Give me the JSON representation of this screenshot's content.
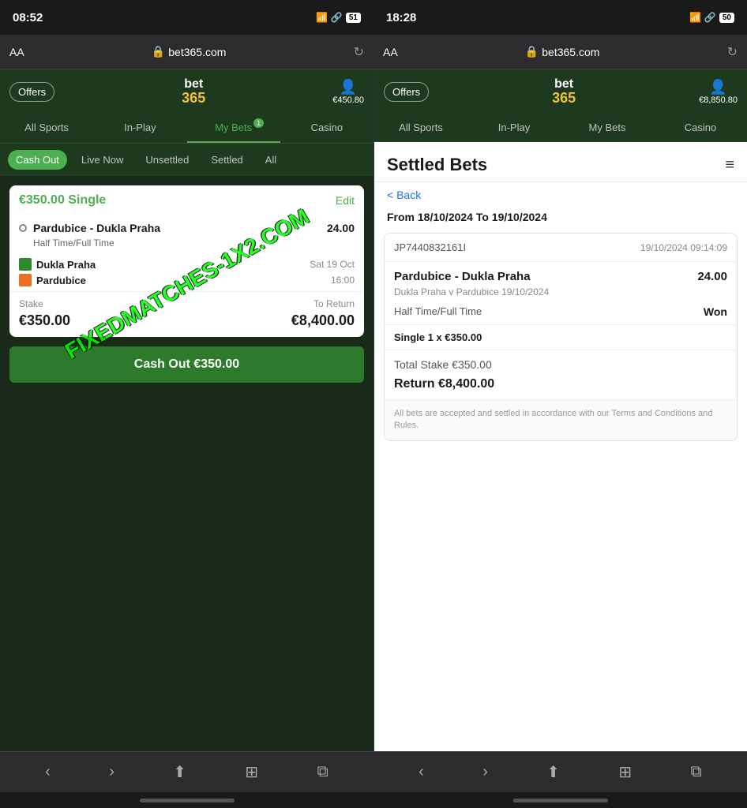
{
  "left": {
    "status": {
      "time": "08:52",
      "signal": "●●●",
      "battery": "51"
    },
    "browser": {
      "aa": "AA",
      "url": "bet365.com",
      "lock": "🔒"
    },
    "nav": {
      "offers": "Offers",
      "logo_bet": "bet",
      "logo_365": "365",
      "balance": "€450.80"
    },
    "tabs": [
      {
        "label": "All Sports",
        "active": false
      },
      {
        "label": "In-Play",
        "active": false
      },
      {
        "label": "My Bets",
        "active": true,
        "badge": "1"
      },
      {
        "label": "Casino",
        "active": false
      }
    ],
    "sub_tabs": [
      {
        "label": "Cash Out",
        "active": true
      },
      {
        "label": "Live Now",
        "active": false
      },
      {
        "label": "Unsettled",
        "active": false
      },
      {
        "label": "Settled",
        "active": false
      },
      {
        "label": "All",
        "active": false
      }
    ],
    "bet": {
      "amount": "€350.00",
      "type": "Single",
      "edit": "Edit",
      "match": "Pardubice - Dukla Praha",
      "odds": "24.00",
      "market": "Half Time/Full Time",
      "team1": "Dukla Praha",
      "team2": "Pardubice",
      "date": "Sat 19 Oct",
      "time": "16:00",
      "stake_label": "Stake",
      "return_label": "To Return",
      "stake": "€350.00",
      "to_return": "€8,400.00",
      "cash_out_btn": "Cash Out  €350.00"
    }
  },
  "right": {
    "status": {
      "time": "18:28",
      "signal": "●●●",
      "battery": "50"
    },
    "browser": {
      "aa": "AA",
      "url": "bet365.com"
    },
    "nav": {
      "offers": "Offers",
      "logo_bet": "bet",
      "logo_365": "365",
      "balance": "€8,850.80"
    },
    "tabs": [
      {
        "label": "All Sports",
        "active": false
      },
      {
        "label": "In-Play",
        "active": false
      },
      {
        "label": "My Bets",
        "active": false
      },
      {
        "label": "Casino",
        "active": false
      }
    ],
    "settled": {
      "title": "Settled Bets",
      "back": "< Back",
      "date_range": "From 18/10/2024 To 19/10/2024",
      "bet_ref": "JP7440832161I",
      "timestamp": "19/10/2024 09:14:09",
      "match": "Pardubice - Dukla Praha",
      "odds": "24.00",
      "subtitle": "Dukla Praha v Pardubice 19/10/2024",
      "market": "Half Time/Full Time",
      "result": "Won",
      "single": "Single 1 x €350.00",
      "total_stake": "Total Stake €350.00",
      "return": "Return €8,400.00",
      "disclaimer": "All bets are accepted and settled in accordance with our Terms and Conditions and Rules."
    }
  },
  "watermark": "FIXEDMATCHES-1X2.COM",
  "bottom": {
    "left": {
      "icons": [
        "‹",
        "›",
        "⬆",
        "⊞",
        "⧉"
      ]
    },
    "right": {
      "icons": [
        "‹",
        "›",
        "⬆",
        "⊞",
        "⧉"
      ]
    }
  }
}
